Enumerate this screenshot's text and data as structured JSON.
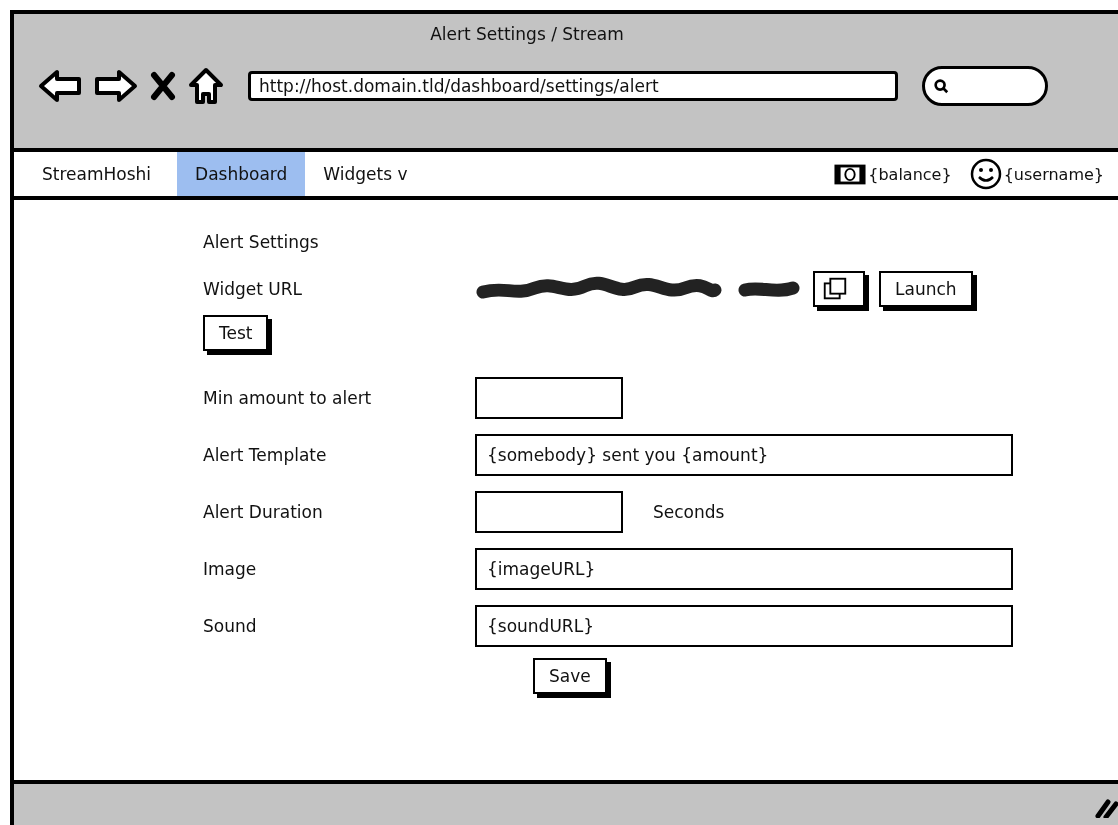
{
  "window": {
    "title": "Alert Settings / Stream"
  },
  "browser": {
    "url": "http://host.domain.tld/dashboard/settings/alert"
  },
  "nav": {
    "brand": "StreamHoshi",
    "tabs": [
      {
        "label": "Dashboard",
        "selected": true
      },
      {
        "label": "Widgets v",
        "selected": false
      }
    ],
    "balance": "{balance}",
    "username": "{username}"
  },
  "form": {
    "heading": "Alert Settings",
    "widget_url": {
      "label": "Widget URL",
      "launch": "Launch"
    },
    "test_button": "Test",
    "fields": [
      {
        "label": "Min amount to alert",
        "kind": "short"
      },
      {
        "label": "Alert Template",
        "kind": "long",
        "value": "{somebody} sent you {amount}"
      },
      {
        "label": "Alert Duration",
        "kind": "short",
        "suffix": "Seconds"
      },
      {
        "label": "Image",
        "kind": "long",
        "value": "{imageURL}"
      },
      {
        "label": "Sound",
        "kind": "long",
        "value": "{soundURL}"
      }
    ],
    "save_button": "Save"
  }
}
